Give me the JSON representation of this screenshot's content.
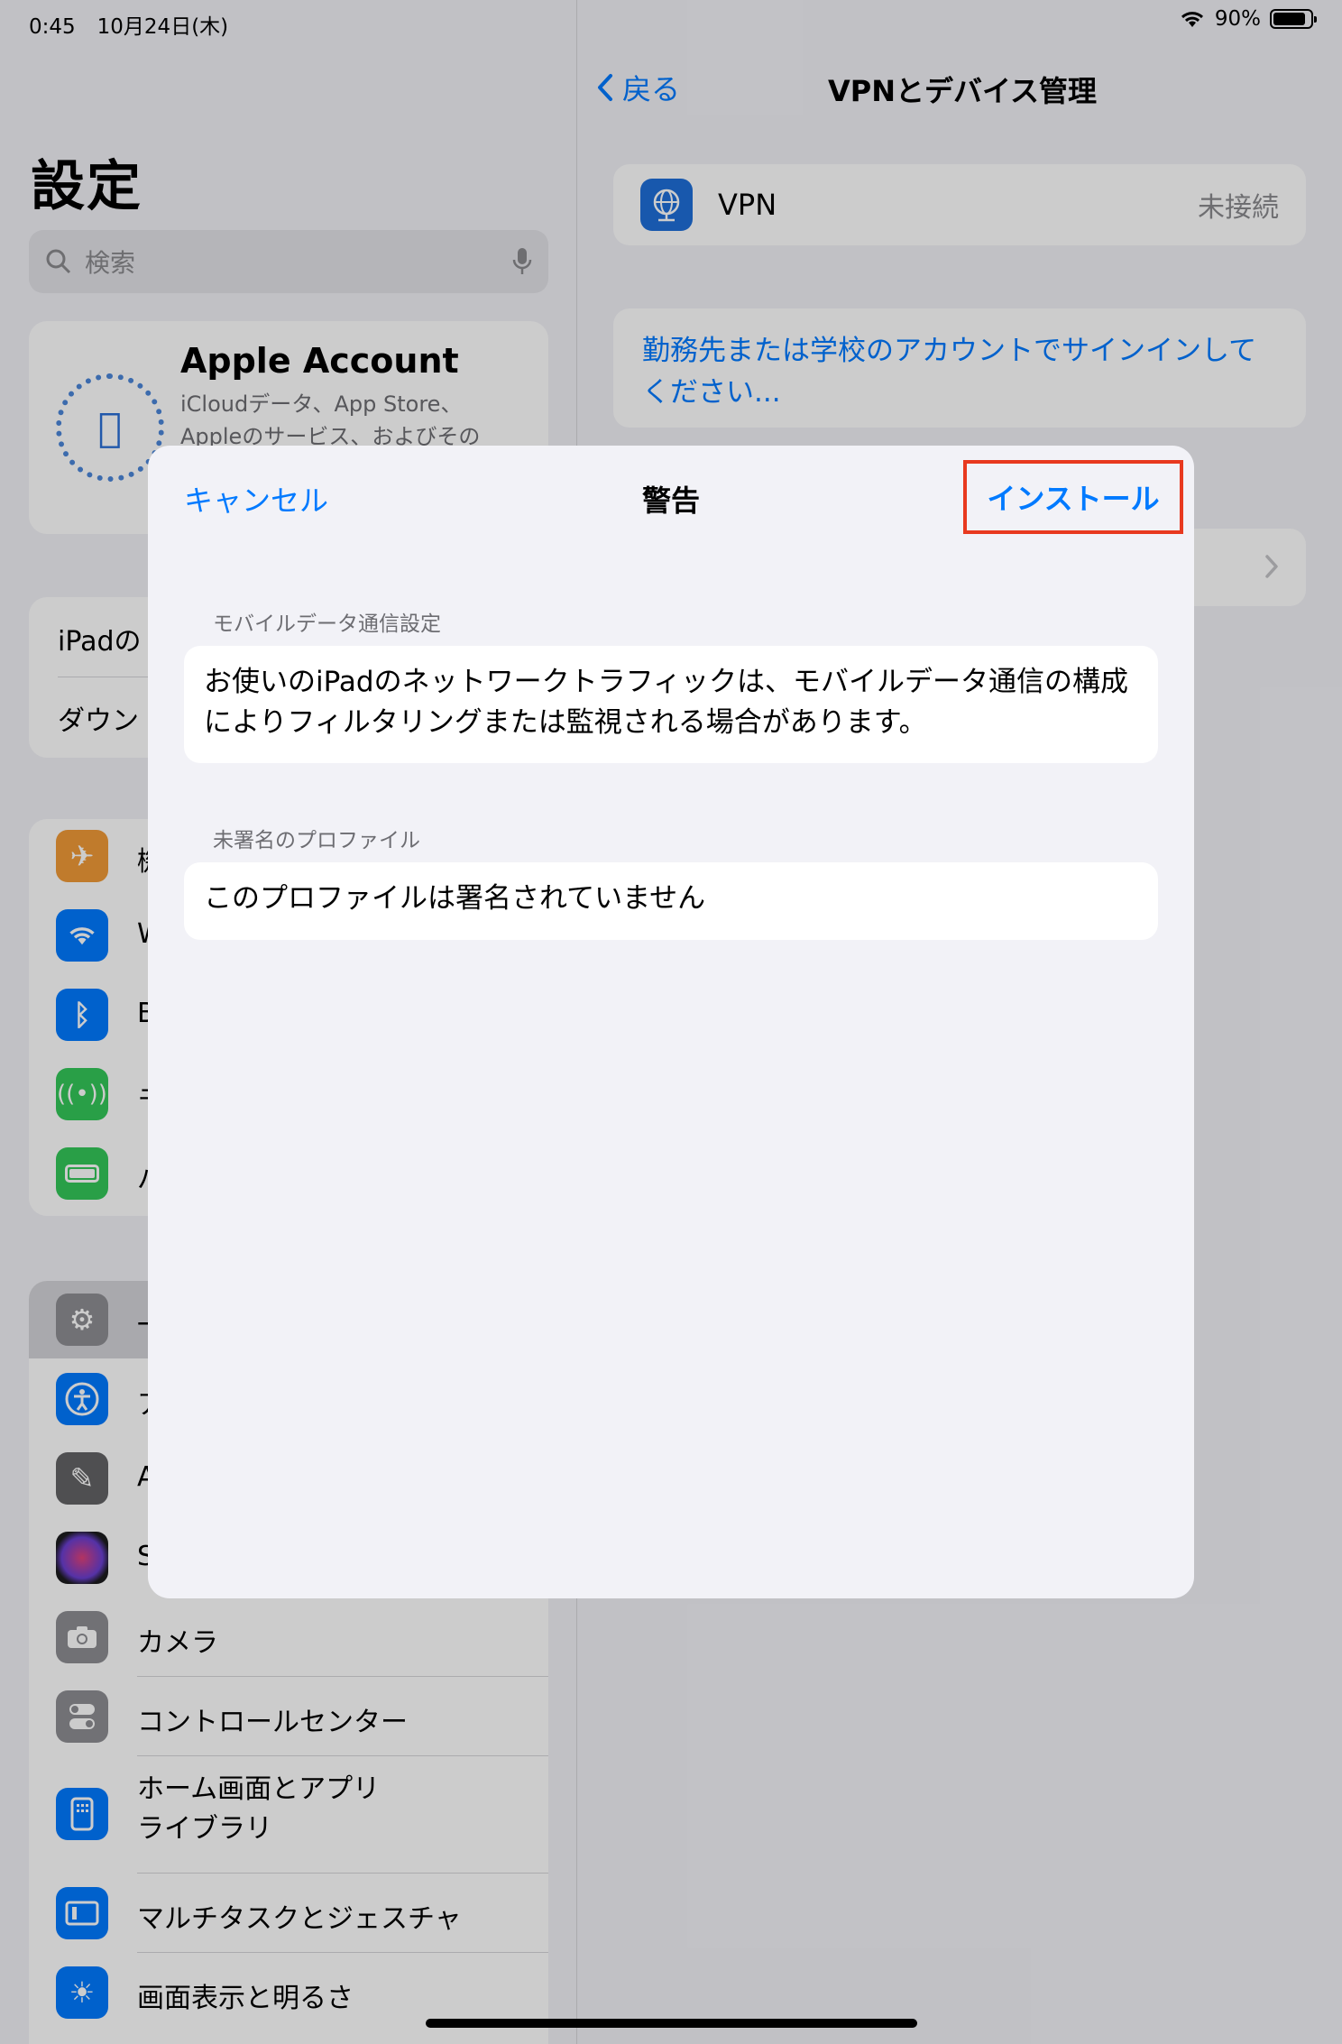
{
  "status_bar": {
    "time": "0:45",
    "date": "10月24日(木)",
    "battery": "90%"
  },
  "sidebar": {
    "title": "設定",
    "search_placeholder": "検索",
    "account": {
      "name": "Apple Account",
      "subtitle_1": "iCloudデータ、App Store、",
      "subtitle_2": "Appleのサービス、およびその"
    },
    "group1": [
      {
        "label": "iPadの"
      },
      {
        "label": "ダウン"
      }
    ],
    "group2": [
      {
        "label": "機",
        "icon": "airplane-icon",
        "color": "#f09a37"
      },
      {
        "label": "W",
        "icon": "wifi-icon",
        "color": "#007aff"
      },
      {
        "label": "B",
        "icon": "bluetooth-icon",
        "color": "#007aff"
      },
      {
        "label": "モ",
        "icon": "cellular-icon",
        "color": "#34c759"
      },
      {
        "label": "バ",
        "icon": "battery-icon",
        "color": "#34c759"
      }
    ],
    "group3": [
      {
        "label": "一",
        "icon": "gear-icon",
        "color": "#8e8e93"
      },
      {
        "label": "ア",
        "icon": "accessibility-icon",
        "color": "#007aff"
      },
      {
        "label": "A",
        "icon": "pencil-icon",
        "color": "#636366"
      },
      {
        "label": "S",
        "icon": "siri-icon",
        "color": "#1c1c1e"
      },
      {
        "label": "カメラ",
        "icon": "camera-icon",
        "color": "#8e8e93"
      },
      {
        "label": "コントロールセンター",
        "icon": "switches-icon",
        "color": "#8e8e93"
      },
      {
        "label": "ホーム画面とアプリ",
        "label_2": "ライブラリ",
        "icon": "home-screen-icon",
        "color": "#007aff"
      },
      {
        "label": "マルチタスクとジェスチャ",
        "icon": "multitask-icon",
        "color": "#007aff"
      },
      {
        "label": "画面表示と明るさ",
        "icon": "brightness-icon",
        "color": "#007aff"
      }
    ]
  },
  "detail": {
    "back_label": "戻る",
    "title": "VPNとデバイス管理",
    "vpn_label": "VPN",
    "vpn_status": "未接続",
    "signin_text": "勤務先または学校のアカウントでサインインしてください..."
  },
  "sheet": {
    "cancel_label": "キャンセル",
    "title": "警告",
    "install_label": "インストール",
    "section1_header": "モバイルデータ通信設定",
    "section1_text": "お使いのiPadのネットワークトラフィックは、モバイルデータ通信の構成によりフィルタリングまたは監視される場合があります。",
    "section2_header": "未署名のプロファイル",
    "section2_text": "このプロファイルは署名されていません"
  },
  "colors": {
    "accent": "#007aff",
    "highlight": "#e8391f"
  }
}
